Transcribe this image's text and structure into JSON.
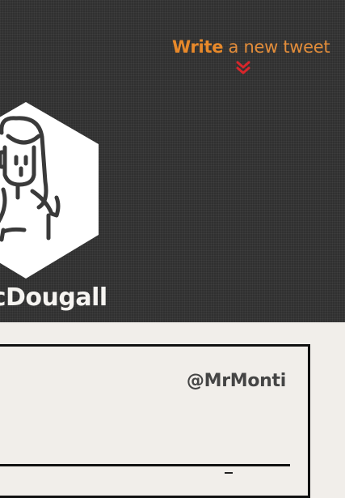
{
  "compose": {
    "strong": "Write",
    "rest": "a new tweet"
  },
  "profile": {
    "name_visible": "acDougall",
    "handle": "@MrMonti"
  },
  "icons": {
    "compose_expand": "double-chevron-down-icon",
    "avatar": "avatar-illustration"
  },
  "colors": {
    "accent": "#e8892a",
    "chevron": "#d8262b",
    "header_bg": "#303030",
    "page_bg": "#f1eeea"
  }
}
